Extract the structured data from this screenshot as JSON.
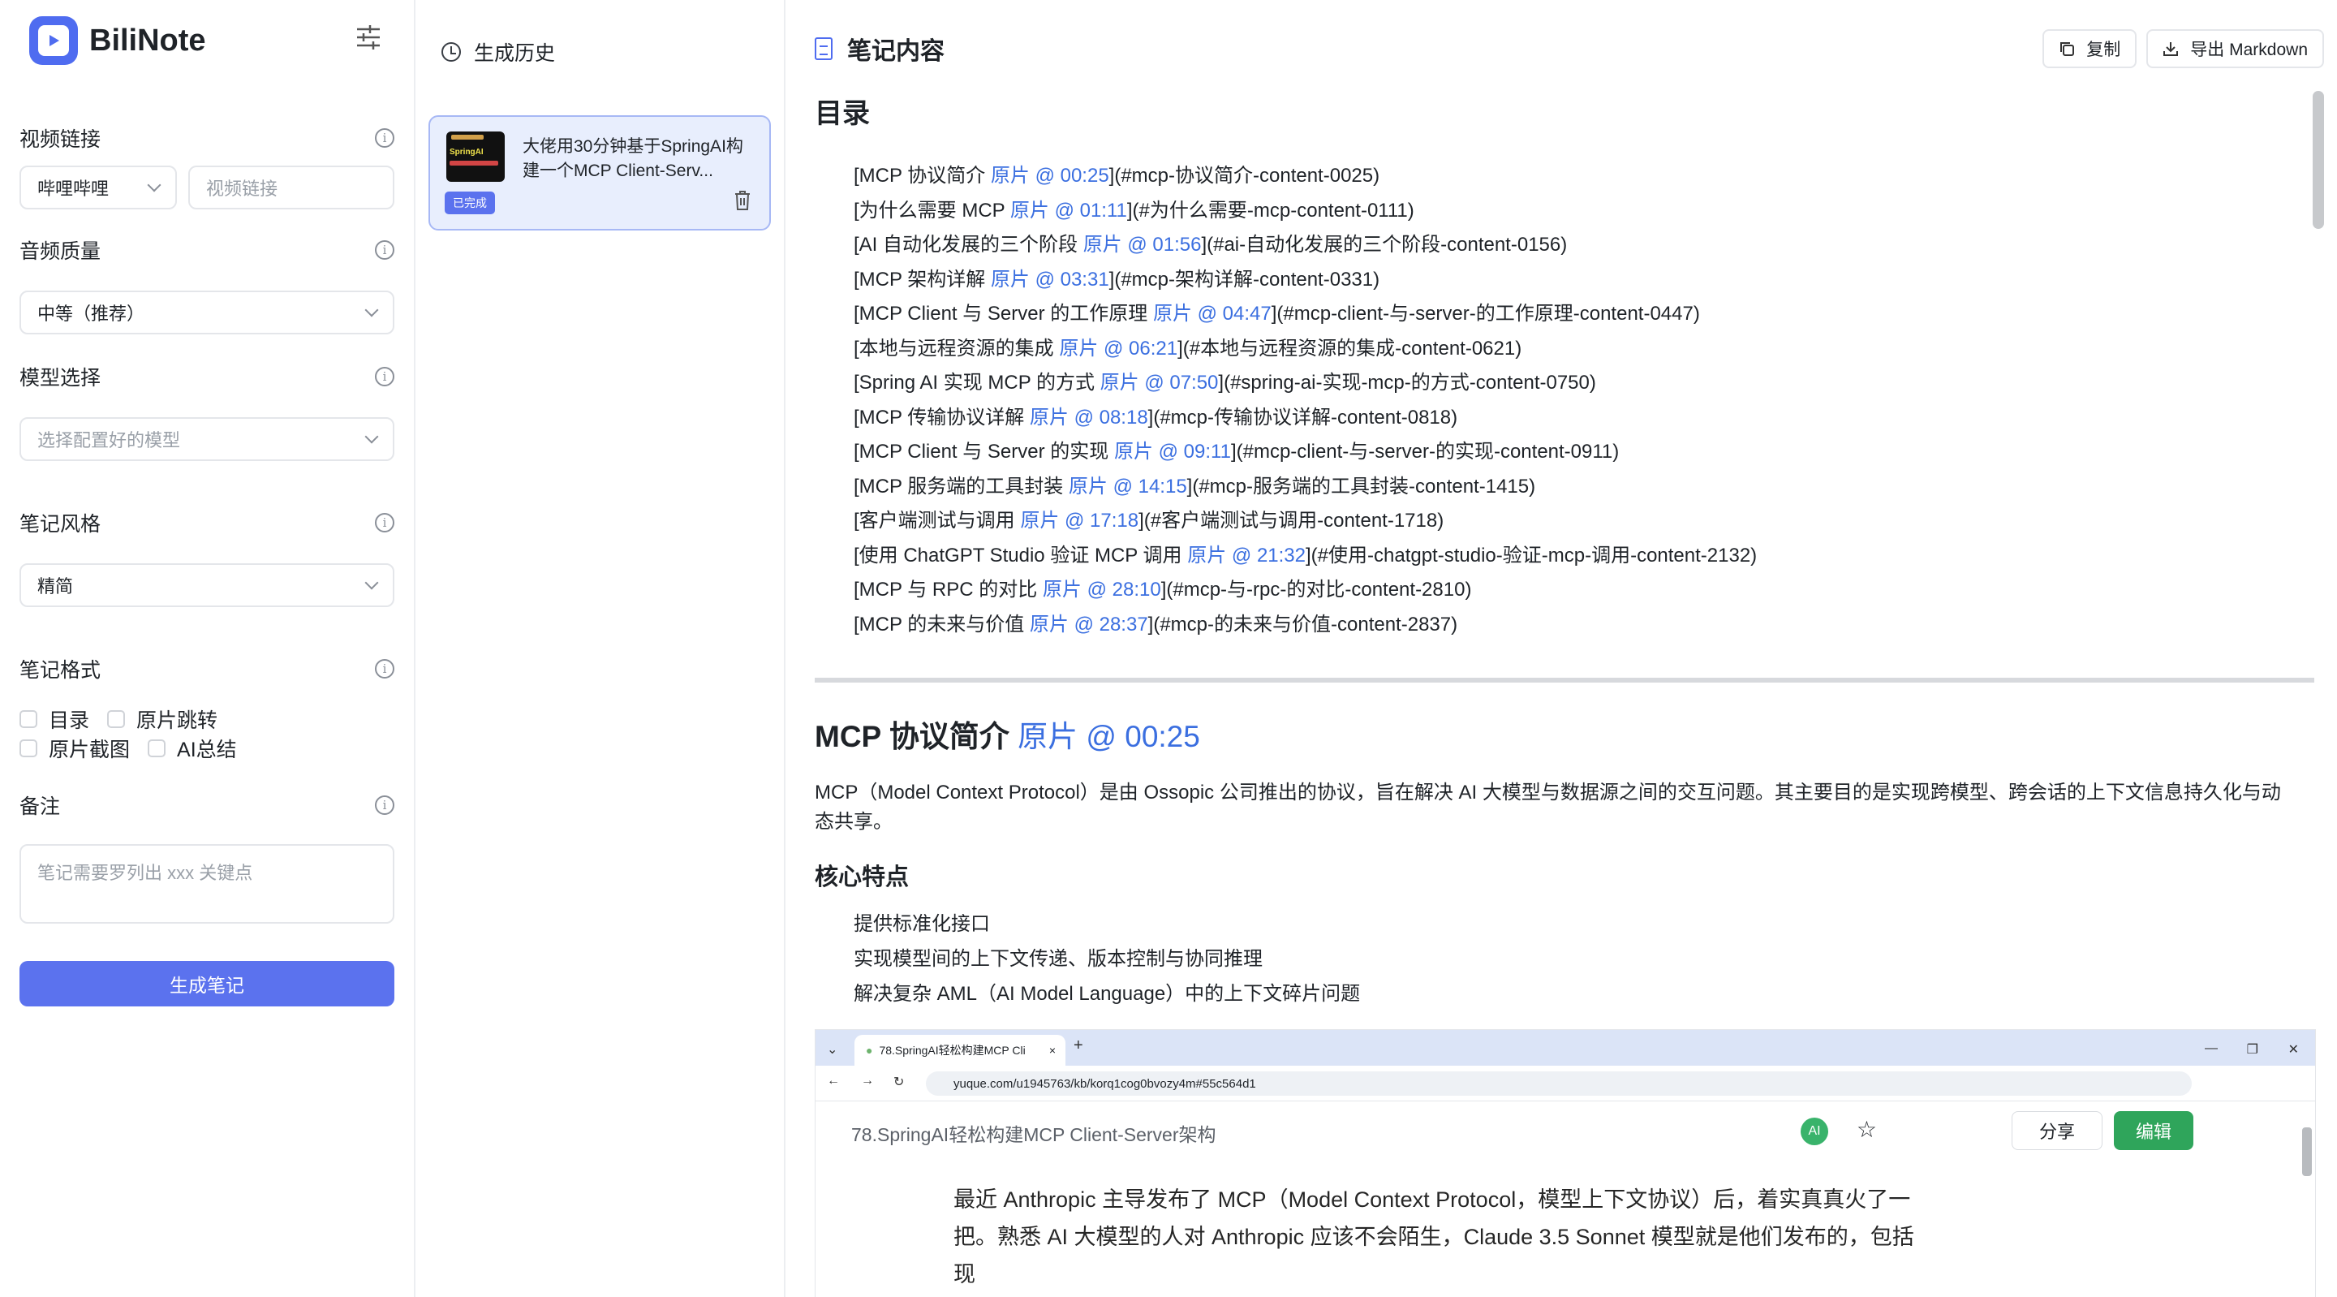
{
  "app": {
    "name": "BiliNote"
  },
  "form": {
    "video_link_label": "视频链接",
    "platform_value": "哔哩哔哩",
    "video_link_placeholder": "视频链接",
    "audio_quality_label": "音频质量",
    "audio_quality_value": "中等（推荐）",
    "model_label": "模型选择",
    "model_placeholder": "选择配置好的模型",
    "style_label": "笔记风格",
    "style_value": "精简",
    "format_label": "笔记格式",
    "format_options": [
      "目录",
      "原片跳转",
      "原片截图",
      "AI总结"
    ],
    "remark_label": "备注",
    "remark_placeholder": "笔记需要罗列出 xxx 关键点",
    "submit_label": "生成笔记"
  },
  "history": {
    "title": "生成历史",
    "items": [
      {
        "title": "大佬用30分钟基于SpringAI构建一个MCP Client-Serv...",
        "status": "已完成",
        "thumb_text": "SpringAI"
      }
    ]
  },
  "content": {
    "title": "笔记内容",
    "copy_label": "复制",
    "export_label": "导出 Markdown",
    "toc_heading": "目录",
    "link_word": "原片",
    "toc": [
      {
        "pre": "[MCP 协议简介 ",
        "time": "@ 00:25",
        "post": "](#mcp-协议简介-content-0025)"
      },
      {
        "pre": "[为什么需要 MCP ",
        "time": "@ 01:11",
        "post": "](#为什么需要-mcp-content-0111)"
      },
      {
        "pre": "[AI 自动化发展的三个阶段 ",
        "time": "@ 01:56",
        "post": "](#ai-自动化发展的三个阶段-content-0156)"
      },
      {
        "pre": "[MCP 架构详解 ",
        "time": "@ 03:31",
        "post": "](#mcp-架构详解-content-0331)"
      },
      {
        "pre": "[MCP Client 与 Server 的工作原理 ",
        "time": "@ 04:47",
        "post": "](#mcp-client-与-server-的工作原理-content-0447)"
      },
      {
        "pre": "[本地与远程资源的集成 ",
        "time": "@ 06:21",
        "post": "](#本地与远程资源的集成-content-0621)"
      },
      {
        "pre": "[Spring AI 实现 MCP 的方式 ",
        "time": "@ 07:50",
        "post": "](#spring-ai-实现-mcp-的方式-content-0750)"
      },
      {
        "pre": "[MCP 传输协议详解 ",
        "time": "@ 08:18",
        "post": "](#mcp-传输协议详解-content-0818)"
      },
      {
        "pre": "[MCP Client 与 Server 的实现 ",
        "time": "@ 09:11",
        "post": "](#mcp-client-与-server-的实现-content-0911)"
      },
      {
        "pre": "[MCP 服务端的工具封装 ",
        "time": "@ 14:15",
        "post": "](#mcp-服务端的工具封装-content-1415)"
      },
      {
        "pre": "[客户端测试与调用 ",
        "time": "@ 17:18",
        "post": "](#客户端测试与调用-content-1718)"
      },
      {
        "pre": "[使用 ChatGPT Studio 验证 MCP 调用 ",
        "time": "@ 21:32",
        "post": "](#使用-chatgpt-studio-验证-mcp-调用-content-2132)"
      },
      {
        "pre": "[MCP 与 RPC 的对比 ",
        "time": "@ 28:10",
        "post": "](#mcp-与-rpc-的对比-content-2810)"
      },
      {
        "pre": "[MCP 的未来与价值 ",
        "time": "@ 28:37",
        "post": "](#mcp-的未来与价值-content-2837)"
      }
    ],
    "section1": {
      "heading": "MCP 协议简介",
      "time": "@ 00:25",
      "paragraph": "MCP（Model Context Protocol）是由 Ossopic 公司推出的协议，旨在解决 AI 大模型与数据源之间的交互问题。其主要目的是实现跨模型、跨会话的上下文信息持久化与动态共享。",
      "subheading": "核心特点",
      "bullets": [
        "提供标准化接口",
        "实现模型间的上下文传递、版本控制与协同推理",
        "解决复杂 AML（AI Model Language）中的上下文碎片问题"
      ]
    },
    "screenshot": {
      "tab_title": "78.SpringAI轻松构建MCP Cli",
      "url": "yuque.com/u1945763/kb/korq1cog0bvozy4m#55c564d1",
      "doc_title": "78.SpringAI轻松构建MCP Client-Server架构",
      "share_label": "分享",
      "edit_label": "编辑",
      "ai_badge": "AI",
      "body_line1": "最近 Anthropic 主导发布了 MCP（Model Context Protocol，模型上下文协议）后，着实真真火了一",
      "body_line2": "把。熟悉 AI 大模型的人对 Anthropic 应该不会陌生，Claude 3.5 Sonnet 模型就是他们发布的，包括现"
    }
  },
  "colors": {
    "accent": "#5b72ee",
    "link": "#3b6fe0",
    "edit_green": "#2fa55b"
  }
}
